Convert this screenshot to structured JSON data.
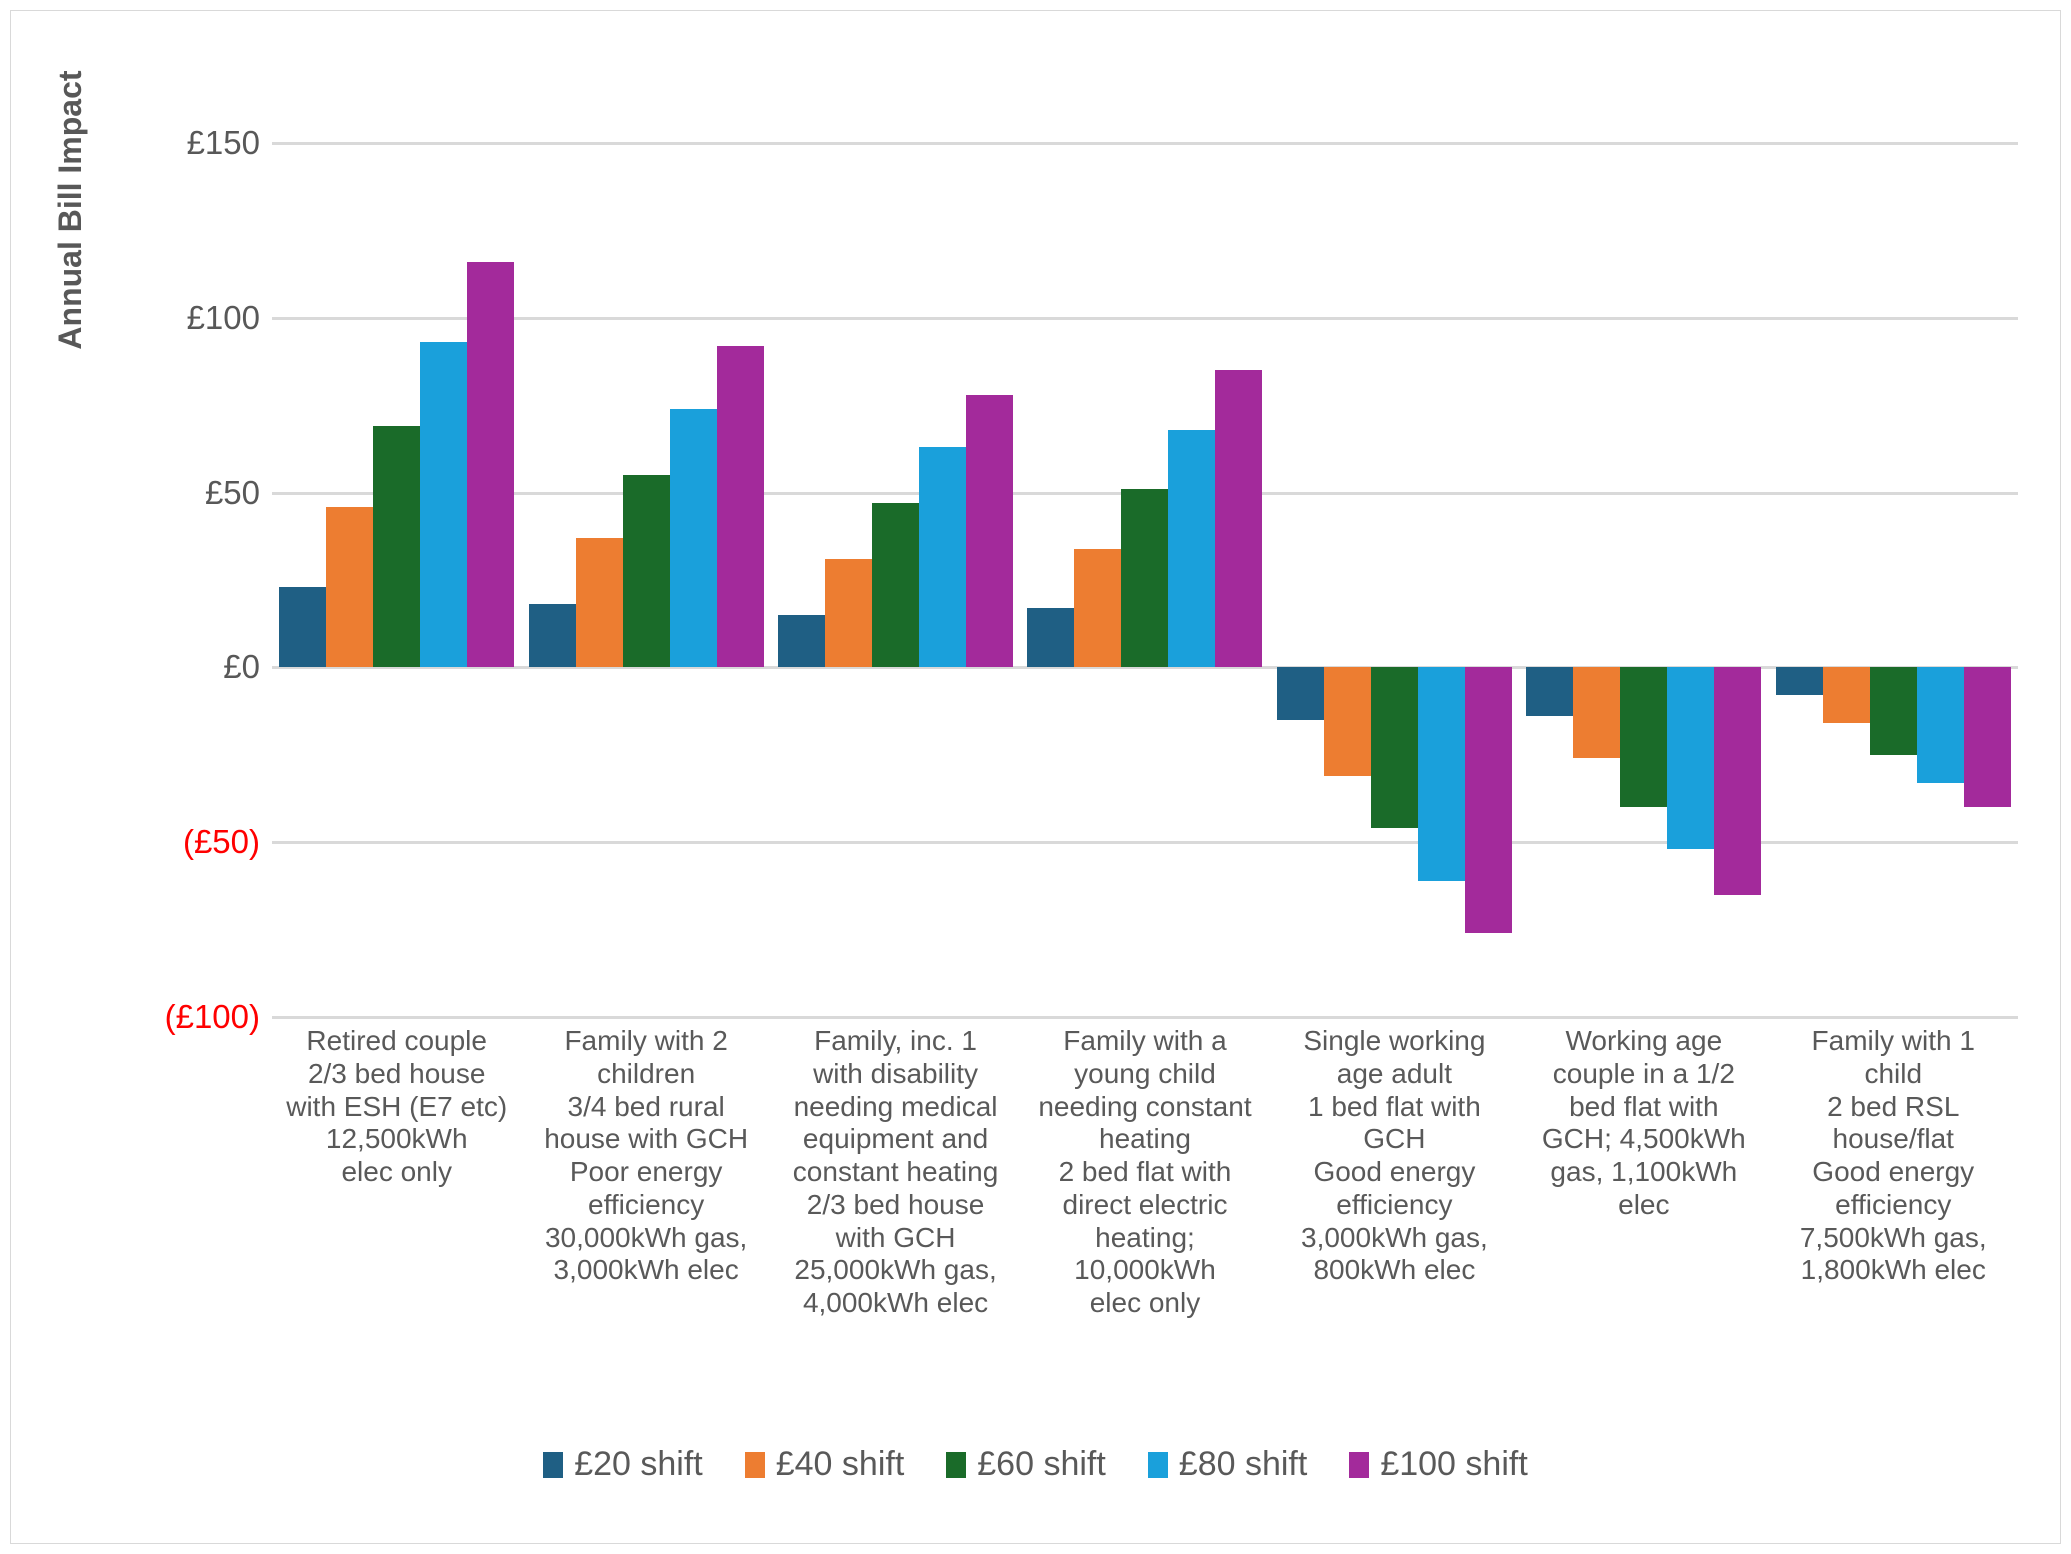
{
  "axis": {
    "y_title": "Annual Bill Impact",
    "y_ticks": [
      {
        "label": "£150",
        "value": 150,
        "negative": false
      },
      {
        "label": "£100",
        "value": 100,
        "negative": false
      },
      {
        "label": "£50",
        "value": 50,
        "negative": false
      },
      {
        "label": "£0",
        "value": 0,
        "negative": false
      },
      {
        "label": "(£50)",
        "value": -50,
        "negative": true
      },
      {
        "label": "(£100)",
        "value": -100,
        "negative": true
      }
    ]
  },
  "legend": {
    "items": [
      {
        "label": "£20 shift",
        "color": "#1f5f84"
      },
      {
        "label": "£40 shift",
        "color": "#ed7d31"
      },
      {
        "label": "£60 shift",
        "color": "#1a6b29"
      },
      {
        "label": "£80 shift",
        "color": "#1aa0db"
      },
      {
        "label": "£100 shift",
        "color": "#a32a9b"
      }
    ]
  },
  "chart_data": {
    "type": "bar",
    "title": "",
    "xlabel": "",
    "ylabel": "Annual Bill Impact",
    "ylim": [
      -100,
      150
    ],
    "ytick_values": [
      150,
      100,
      50,
      0,
      -50,
      -100
    ],
    "ytick_labels": [
      "£150",
      "£100",
      "£50",
      "£0",
      "(£50)",
      "(£100)"
    ],
    "grid": true,
    "legend_position": "bottom",
    "currency": "GBP",
    "negative_format": "parentheses-red",
    "categories": [
      "Retired couple\n2/3 bed house\nwith ESH (E7 etc)\n12,500kWh\nelec only",
      "Family with 2\nchildren\n3/4 bed rural\nhouse with GCH\nPoor energy\nefficiency\n30,000kWh gas,\n3,000kWh elec",
      "Family, inc. 1\nwith disability\nneeding medical\nequipment and\nconstant heating\n2/3 bed house\nwith GCH\n25,000kWh gas,\n4,000kWh elec",
      "Family with a\nyoung child\nneeding constant\nheating\n2 bed flat with\ndirect electric\nheating;\n10,000kWh\nelec only",
      "Single working\nage adult\n1 bed flat with\nGCH\nGood energy\nefficiency\n3,000kWh gas,\n800kWh elec",
      "Working age\ncouple in a 1/2\nbed flat with\nGCH; 4,500kWh\ngas, 1,100kWh\nelec",
      "Family with 1\nchild\n2 bed RSL\nhouse/flat\nGood energy\nefficiency\n7,500kWh gas,\n1,800kWh elec"
    ],
    "series": [
      {
        "name": "£20 shift",
        "color": "#1f5f84",
        "values": [
          23,
          18,
          15,
          17,
          -15,
          -14,
          -8
        ]
      },
      {
        "name": "£40 shift",
        "color": "#ed7d31",
        "values": [
          46,
          37,
          31,
          34,
          -31,
          -26,
          -16
        ]
      },
      {
        "name": "£60 shift",
        "color": "#1a6b29",
        "values": [
          69,
          55,
          47,
          51,
          -46,
          -40,
          -25
        ]
      },
      {
        "name": "£80 shift",
        "color": "#1aa0db",
        "values": [
          93,
          74,
          63,
          68,
          -61,
          -52,
          -33
        ]
      },
      {
        "name": "£100 shift",
        "color": "#a32a9b",
        "values": [
          116,
          92,
          78,
          85,
          -76,
          -65,
          -40
        ]
      }
    ]
  }
}
